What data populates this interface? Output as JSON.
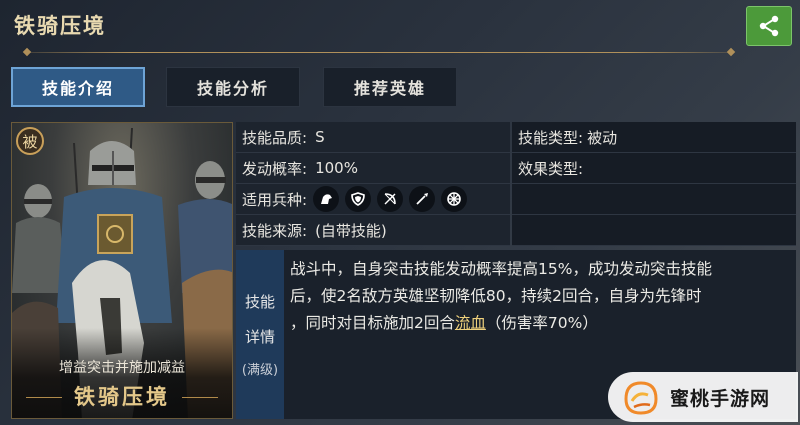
{
  "header": {
    "title": "铁骑压境",
    "share_icon": "share-icon"
  },
  "tabs": [
    {
      "label": "技能介绍",
      "active": true
    },
    {
      "label": "技能分析",
      "active": false
    },
    {
      "label": "推荐英雄",
      "active": false
    }
  ],
  "card": {
    "badge": "被",
    "subtitle": "增益突击并施加减益",
    "name": "铁骑压境"
  },
  "info": {
    "quality_label": "技能品质:",
    "quality_value": "S",
    "type_label": "技能类型:",
    "type_value": "被动",
    "rate_label": "发动概率:",
    "rate_value": "100%",
    "effect_label": "效果类型:",
    "effect_value": "",
    "troops_label": "适用兵种:",
    "troop_icons": [
      "cavalry-icon",
      "shield-icon",
      "bow-icon",
      "spear-icon",
      "wheel-icon"
    ],
    "source_label": "技能来源:",
    "source_value": "(自带技能)"
  },
  "detail": {
    "label_line1": "技能",
    "label_line2": "详情",
    "label_line3": "(满级)",
    "text_line1": "战斗中，自身突击技能发动概率提高15%，成功发动突击技能",
    "text_line2": "后，使2名敌方英雄坚韧降低80，持续2回合，自身为先锋时",
    "text_line3_pre": "，同时对目标施加2回合",
    "text_line3_link": "流血",
    "text_line3_post": "（伤害率70%）"
  },
  "watermark": {
    "text": "蜜桃手游网"
  },
  "colors": {
    "active_tab": "#2f5a86",
    "share_button": "#4c9a3a",
    "link_gold": "#f0d27c"
  }
}
